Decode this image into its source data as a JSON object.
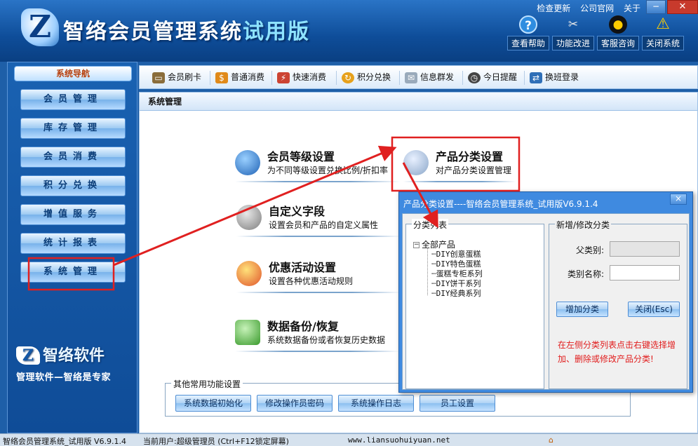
{
  "header": {
    "logo_letter": "Z",
    "title_main": "智络会员管理系统",
    "title_trial": "试用版",
    "top_links": [
      "检查更新",
      "公司官网",
      "关于"
    ],
    "buttons": [
      {
        "icon": "question-icon",
        "label": "查看帮助"
      },
      {
        "icon": "tools-icon",
        "label": "功能改进"
      },
      {
        "icon": "qq-penguin-icon",
        "label": "客服咨询"
      },
      {
        "icon": "warning-icon",
        "label": "关闭系统"
      }
    ]
  },
  "sidebar": {
    "title": "系统导航",
    "items": [
      "会员管理",
      "库存管理",
      "会员消费",
      "积分兑换",
      "增值服务",
      "统计报表",
      "系统管理"
    ],
    "brand_letter": "Z",
    "brand_name": "智络软件",
    "brand_slogan": "管理软件—智络是专家"
  },
  "toolbar": {
    "items": [
      {
        "icon": "card-icon",
        "label": "会员刷卡"
      },
      {
        "icon": "coins-icon",
        "label": "普通消费"
      },
      {
        "icon": "lightning-icon",
        "label": "快速消费"
      },
      {
        "icon": "exchange-icon",
        "label": "积分兑换"
      },
      {
        "icon": "mail-icon",
        "label": "信息群发"
      },
      {
        "icon": "clock-icon",
        "label": "今日提醒"
      },
      {
        "icon": "shift-icon",
        "label": "换班登录"
      }
    ]
  },
  "main": {
    "panel_title": "系统管理",
    "functions": [
      {
        "icon": "member-level-icon",
        "name": "会员等级设置",
        "desc": "为不同等级设置兑换比例/折扣率"
      },
      {
        "icon": "product-category-icon",
        "name": "产品分类设置",
        "desc": "对产品分类设置管理"
      },
      {
        "icon": "custom-field-icon",
        "name": "自定义字段",
        "desc": "设置会员和产品的自定义属性"
      },
      {
        "icon": "promotion-icon",
        "name": "优惠活动设置",
        "desc": "设置各种优惠活动规则"
      },
      {
        "icon": "backup-icon",
        "name": "数据备份/恢复",
        "desc": "系统数据备份或者恢复历史数据"
      }
    ],
    "other_legend": "其他常用功能设置",
    "other_buttons": [
      "系统数据初始化",
      "修改操作员密码",
      "系统操作日志",
      "员工设置"
    ]
  },
  "dialog": {
    "title": "产品分类设置----智络会员管理系统_试用版V6.9.1.4",
    "close": "×",
    "tree_legend": "分类列表",
    "tree_root": "全部产品",
    "tree_items": [
      "DIY创意蛋糕",
      "DIY特色蛋糕",
      "蛋糕专柜系列",
      "DIY饼干系列",
      "DIY经典系列"
    ],
    "edit_legend": "新增/修改分类",
    "parent_label": "父类别:",
    "name_label": "类别名称:",
    "parent_value": "",
    "name_value": "",
    "add_button": "增加分类",
    "close_button": "关闭(Esc)",
    "hint": "在左侧分类列表点击右键选择增加、删除或修改产品分类!"
  },
  "status": {
    "app": "智络会员管理系统_试用版 V6.9.1.4",
    "user": "当前用户:超级管理员 (Ctrl+F12锁定屏幕)",
    "url": "www.liansuohuiyuan.net"
  },
  "colors": {
    "header_blue": "#0e4d99",
    "sidebar_blue": "#1558a6",
    "highlight_red": "#e02020",
    "hint_red": "#e11c1c"
  }
}
